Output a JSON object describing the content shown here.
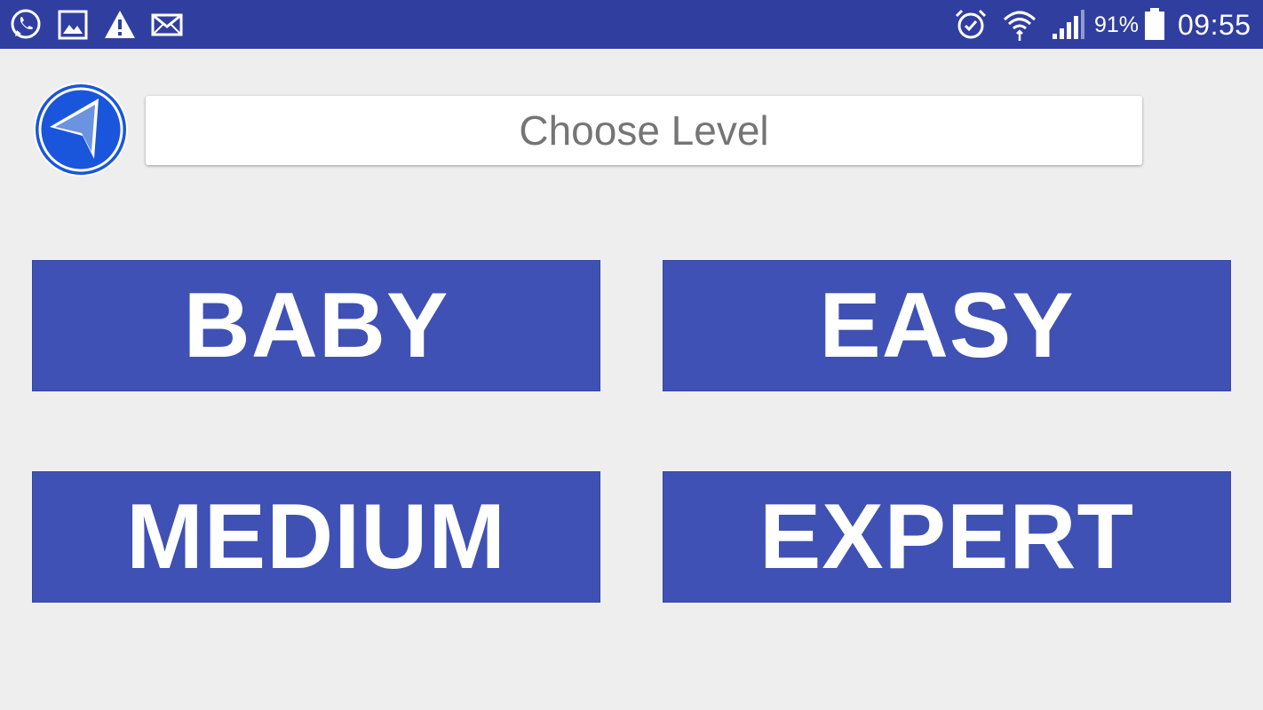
{
  "status_bar": {
    "icons_left": [
      "whatsapp-icon",
      "gallery-icon",
      "warning-icon",
      "mail-icon"
    ],
    "icons_right": [
      "alarm-icon",
      "wifi-icon",
      "signal-icon",
      "battery-icon"
    ],
    "battery_percent": "91%",
    "time": "09:55"
  },
  "header": {
    "back_icon": "back-arrow-icon",
    "title": "Choose Level"
  },
  "levels": [
    {
      "label": "BABY"
    },
    {
      "label": "EASY"
    },
    {
      "label": "MEDIUM"
    },
    {
      "label": "EXPERT"
    }
  ],
  "colors": {
    "status_bar": "#303f9f",
    "button": "#3f51b5",
    "background": "#eeeeee",
    "back_circle": "#1a56db"
  }
}
